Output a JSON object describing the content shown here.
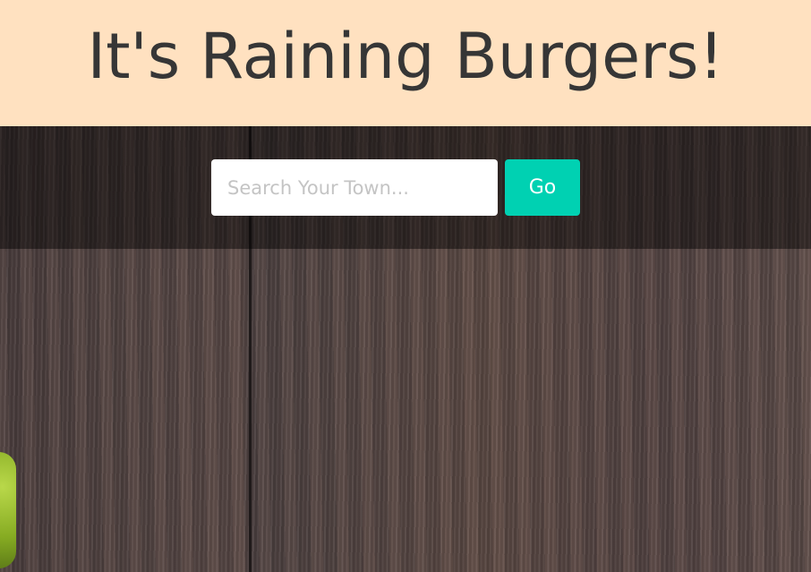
{
  "header": {
    "title": "It's Raining Burgers!"
  },
  "search": {
    "placeholder": "Search Your Town...",
    "value": "",
    "button_label": "Go"
  },
  "colors": {
    "header_bg": "#ffe1c0",
    "button_bg": "#00d1b2"
  }
}
